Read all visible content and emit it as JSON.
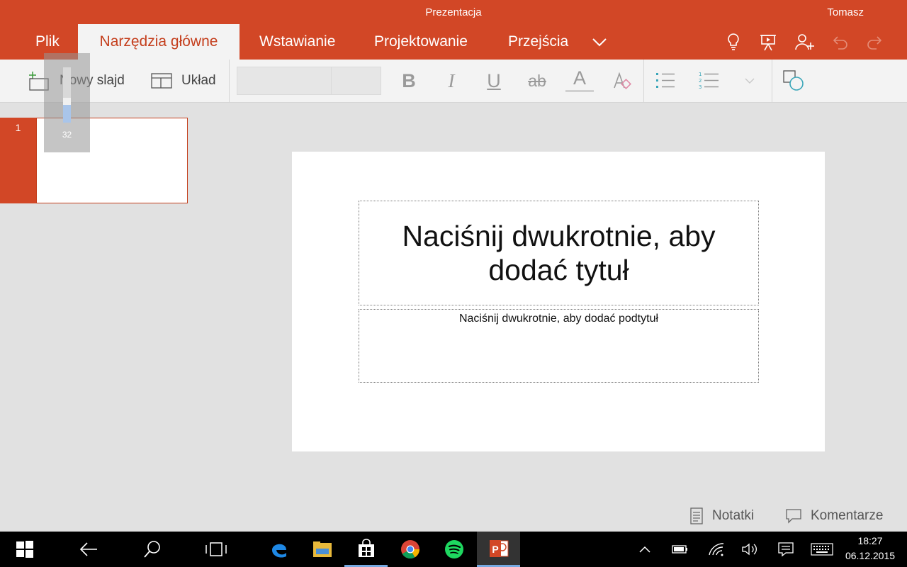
{
  "window": {
    "title": "Prezentacja",
    "user": "Tomasz"
  },
  "tabs": {
    "file": "Plik",
    "home": "Narzędzia główne",
    "insert": "Wstawianie",
    "design": "Projektowanie",
    "transitions": "Przejścia"
  },
  "ribbon": {
    "new_slide": "Nowy slajd",
    "layout": "Układ",
    "font_name": "",
    "font_size": "",
    "bold": "B",
    "italic": "I",
    "underline": "U",
    "strikethrough": "ab",
    "font_color": "A"
  },
  "zoom": {
    "value": "32",
    "level_fraction": 0.32
  },
  "thumbnails": [
    {
      "number": "1"
    }
  ],
  "slide": {
    "title_placeholder": "Naciśnij dwukrotnie, aby dodać tytuł",
    "subtitle_placeholder": "Naciśnij dwukrotnie, aby dodać podtytuł"
  },
  "bottom": {
    "notes": "Notatki",
    "comments": "Komentarze"
  },
  "taskbar": {
    "time": "18:27",
    "date": "06.12.2015",
    "apps": [
      "edge-icon",
      "file-explorer-icon",
      "store-icon",
      "chrome-icon",
      "spotify-icon",
      "powerpoint-icon"
    ]
  },
  "colors": {
    "accent": "#d24726",
    "accent_dark": "#c43e1c",
    "ribbon_bg": "#f3f3f3",
    "workspace_bg": "#e1e1e1",
    "taskbar_bg": "#000000"
  }
}
